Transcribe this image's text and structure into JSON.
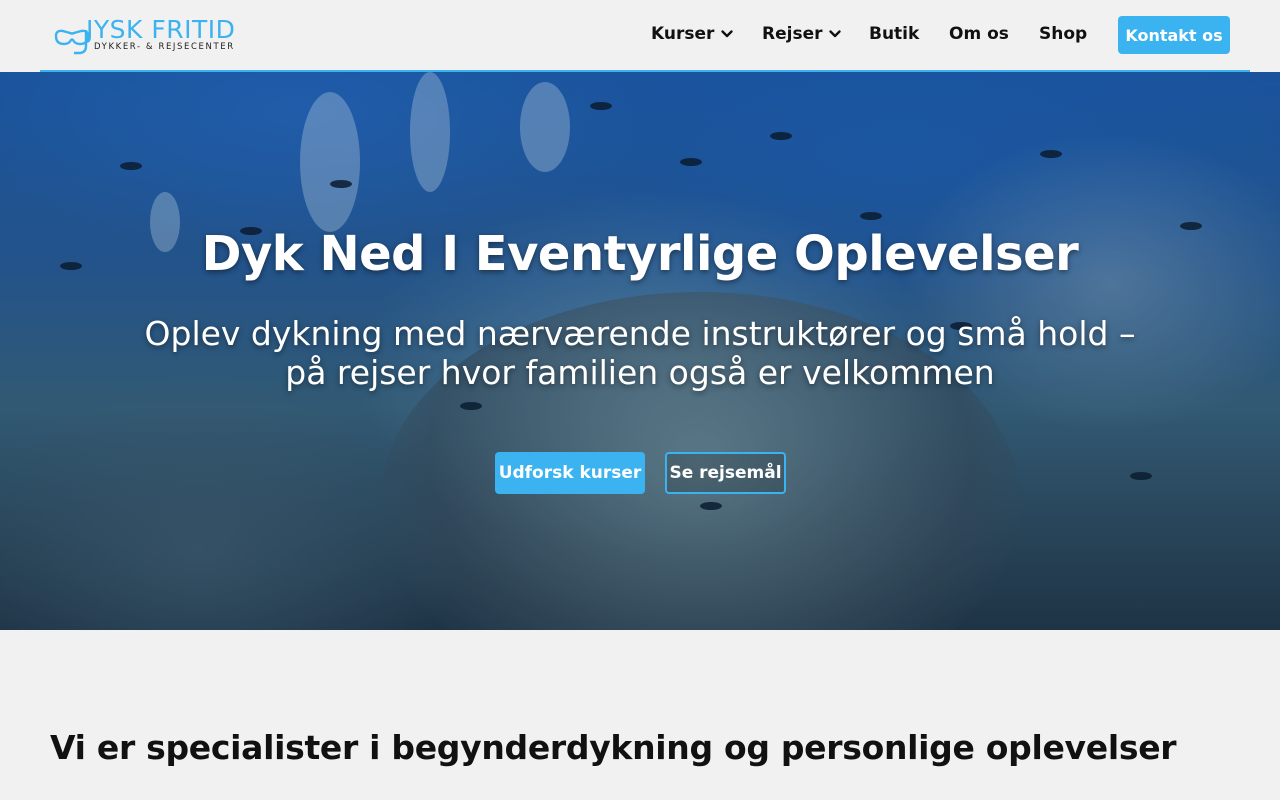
{
  "brand": {
    "name": "JYSK FRITID",
    "tagline": "DYKKER- & REJSECENTER",
    "accent": "#3bb3f0",
    "icon": "dive-mask-icon"
  },
  "nav": {
    "items": [
      {
        "label": "Kurser",
        "dropdown": true
      },
      {
        "label": "Rejser",
        "dropdown": true
      },
      {
        "label": "Butik",
        "dropdown": false
      },
      {
        "label": "Om os",
        "dropdown": false
      },
      {
        "label": "Shop",
        "dropdown": false
      }
    ],
    "cta": "Kontakt os"
  },
  "hero": {
    "title": "Dyk Ned I Eventyrlige Oplevelser",
    "subtitle": "Oplev dykning med nærværende instruktører og små hold – på rejser hvor familien også er velkommen",
    "primary_button": "Udforsk kurser",
    "secondary_button": "Se rejsemål"
  },
  "intro": {
    "heading": "Vi er specialister i begynderdykning og personlige oplevelser"
  }
}
